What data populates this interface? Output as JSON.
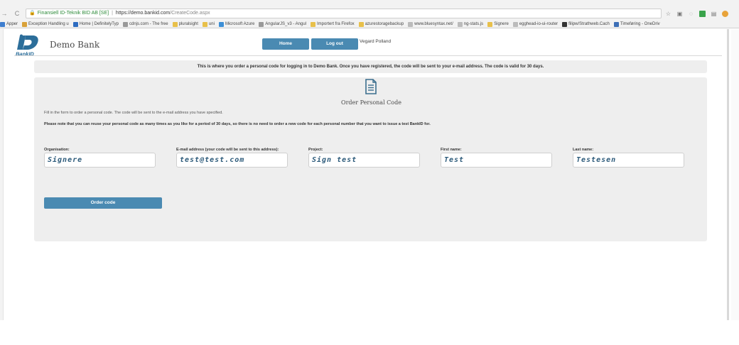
{
  "browser": {
    "site_label": "Finansiell ID-Teknik BID AB [SE]",
    "url_host": "https://demo.bankid.com",
    "url_path": "/CreateCode.aspx",
    "bookmarks": [
      {
        "label": "Apper",
        "color": "#3f7fcf"
      },
      {
        "label": "Exception Handling u",
        "color": "#d9a23a"
      },
      {
        "label": "Home | DefinitelyTyp",
        "color": "#2d6cc0"
      },
      {
        "label": "cdnjs.com - The free",
        "color": "#999999"
      },
      {
        "label": "pluralsight",
        "color": "#e8c04a"
      },
      {
        "label": "uni",
        "color": "#e8c04a"
      },
      {
        "label": "Microsoft Azure",
        "color": "#3d8fd6"
      },
      {
        "label": "AngularJS_v3 - Angul",
        "color": "#999999"
      },
      {
        "label": "Importert fra Firefox",
        "color": "#e8c04a"
      },
      {
        "label": "azurestoragebackup",
        "color": "#e8c04a"
      },
      {
        "label": "www.bluesyntax.net/",
        "color": "#bbbbbb"
      },
      {
        "label": "ng-stats.js",
        "color": "#bbbbbb"
      },
      {
        "label": "Signere",
        "color": "#e8c04a"
      },
      {
        "label": "egghead-io-ui-router",
        "color": "#bbbbbb"
      },
      {
        "label": "filipw/Strathweb.Cach",
        "color": "#333333"
      },
      {
        "label": "Timeføring - OneDriv",
        "color": "#3d6fb6"
      }
    ]
  },
  "header": {
    "logo_text": "BankID",
    "bank_name": "Demo Bank",
    "home_label": "Home",
    "logout_label": "Log out",
    "user_name": "Vegard Polland"
  },
  "info_banner": "This is where you order a personal code for logging in to Demo Bank. Once you have registered, the code will be sent to your e-mail address. The code is valid for 30 days.",
  "form": {
    "title": "Order Personal Code",
    "intro": "Fill in the form to order a personal code. The code will be sent to the e-mail address you have specified.",
    "note": "Please note that you can reuse your personal code as many times as you like for a period of 30 days, so there is no need to order a new code for each personal number that you want to issue a test BankID for.",
    "fields": {
      "organisation": {
        "label": "Organisation:",
        "value": "Signere"
      },
      "email": {
        "label": "E-mail address (your code will be sent to this address):",
        "value": "test@test.com"
      },
      "project": {
        "label": "Project:",
        "value": "Sign test"
      },
      "first_name": {
        "label": "First name:",
        "value": "Test"
      },
      "last_name": {
        "label": "Last name:",
        "value": "Testesen"
      }
    },
    "order_button": "Order code"
  },
  "colors": {
    "button_blue": "#4a8ab2",
    "panel_grey": "#eeeeee",
    "input_text": "#2c5a7a"
  }
}
